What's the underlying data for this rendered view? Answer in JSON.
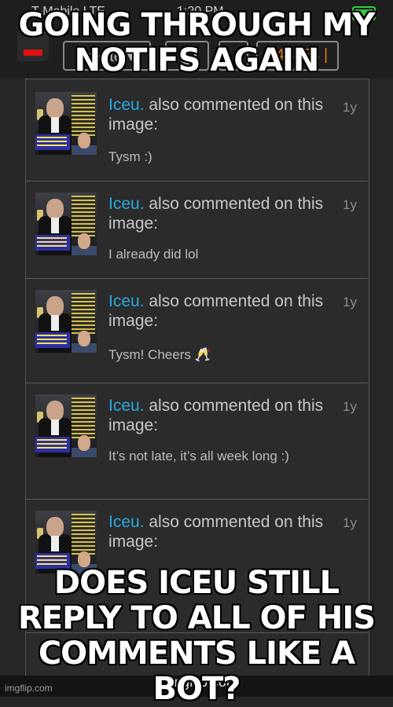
{
  "status_bar": {
    "carrier": "T-Mobile LTE",
    "time": "1:20 PM"
  },
  "header": {
    "create_label": "Create",
    "points": "49354"
  },
  "notifications": [
    {
      "user": "Iceu.",
      "action": "also commented on this image:",
      "comment": "Tysm :)",
      "age": "1y"
    },
    {
      "user": "Iceu.",
      "action": "also commented on this image:",
      "comment": "I already did lol",
      "age": "1y"
    },
    {
      "user": "Iceu.",
      "action": "also commented on this image:",
      "comment": "Tysm! Cheers 🥂",
      "age": "1y"
    },
    {
      "user": "Iceu.",
      "action": "also commented on this image:",
      "comment": "It’s not late, it’s all week long :)",
      "age": "1y"
    },
    {
      "user": "Iceu.",
      "action": "also commented on this image:",
      "comment": "",
      "age": "1y"
    }
  ],
  "url_bar": {
    "url": "imgflip.com"
  },
  "watermark": "imgflip.com",
  "captions": {
    "top": "GOING THROUGH MY NOTIFS AGAIN",
    "bottom": "DOES ICEU STILL REPLY TO ALL OF HIS COMMENTS LIKE A BOT?"
  },
  "colors": {
    "username": "#29a8e0",
    "points": "#e07a10",
    "background": "#262626"
  }
}
